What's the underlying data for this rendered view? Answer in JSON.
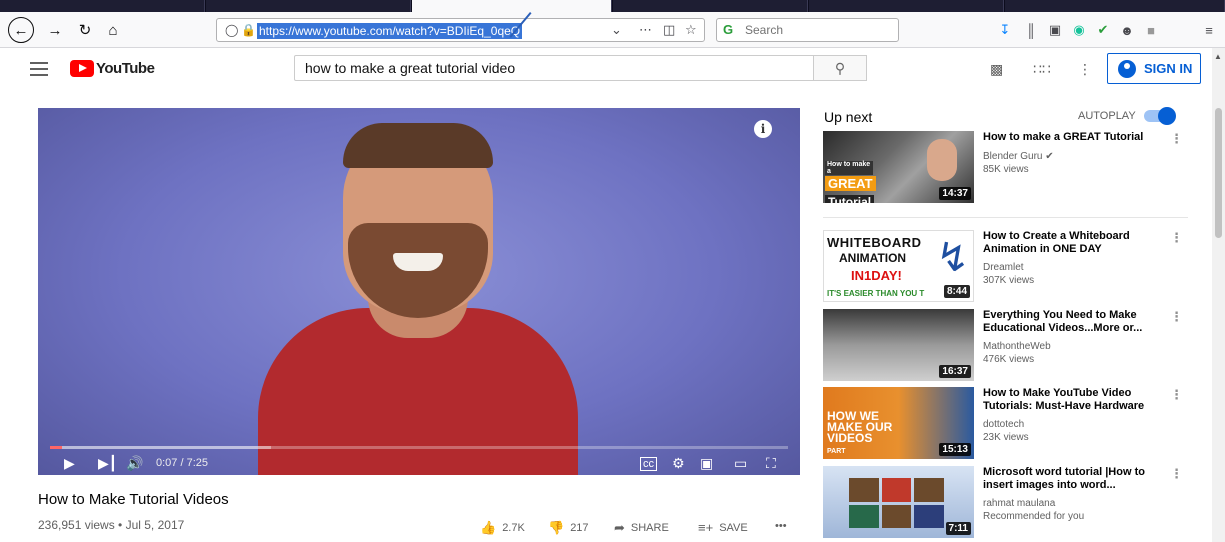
{
  "browser": {
    "url": "https://www.youtube.com/watch?v=BDIiEq_0qeQ",
    "search_placeholder": "Search",
    "icons": [
      "back-icon",
      "forward-icon",
      "reload-icon",
      "home-icon",
      "shield-icon",
      "lock-icon",
      "dropdown-icon",
      "more-icon",
      "pocket-icon",
      "bookmark-star-icon",
      "download-icon",
      "library-icon",
      "reader-icon",
      "grammarly-icon",
      "extension-icon",
      "account-icon",
      "profile-icon",
      "hamburger-menu-icon"
    ]
  },
  "youtube": {
    "logo": "YouTube",
    "search_query": "how to make a great tutorial video",
    "sign_in": "SIGN IN"
  },
  "player": {
    "time": "0:07 / 7:25",
    "progress_fraction": 0.016
  },
  "video": {
    "title": "How to Make Tutorial Videos",
    "views_date": "236,951 views • Jul 5, 2017",
    "likes": "2.7K",
    "dislikes": "217",
    "share": "SHARE",
    "save": "SAVE",
    "more": "•••"
  },
  "sidebar": {
    "up_next": "Up next",
    "autoplay": "AUTOPLAY",
    "autoplay_on": true,
    "items": [
      {
        "title": "How to make a GREAT Tutorial",
        "channel": "Blender Guru ✔",
        "meta": "85K views",
        "duration": "14:37",
        "thumb_text": [
          "How to make a",
          "GREAT",
          "Tutorial"
        ]
      },
      {
        "title": "How to Create a Whiteboard Animation in ONE DAY",
        "channel": "Dreamlet",
        "meta": "307K views",
        "duration": "8:44",
        "thumb_text": [
          "WHITEBOARD",
          "ANIMATION",
          "IN1DAY!",
          "IT'S EASIER THAN YOU T"
        ]
      },
      {
        "title": "Everything You Need to Make Educational Videos...More or...",
        "channel": "MathontheWeb",
        "meta": "476K views",
        "duration": "16:37"
      },
      {
        "title": "How to Make YouTube Video Tutorials: Must-Have Hardware",
        "channel": "dottotech",
        "meta": "23K views",
        "duration": "15:13",
        "thumb_text": [
          "HOW WE",
          "MAKE OUR",
          "VIDEOS",
          "PART"
        ]
      },
      {
        "title": "Microsoft word tutorial |How to insert images into word...",
        "channel": "rahmat maulana",
        "meta": "Recommended for you",
        "duration": "7:11"
      }
    ]
  }
}
